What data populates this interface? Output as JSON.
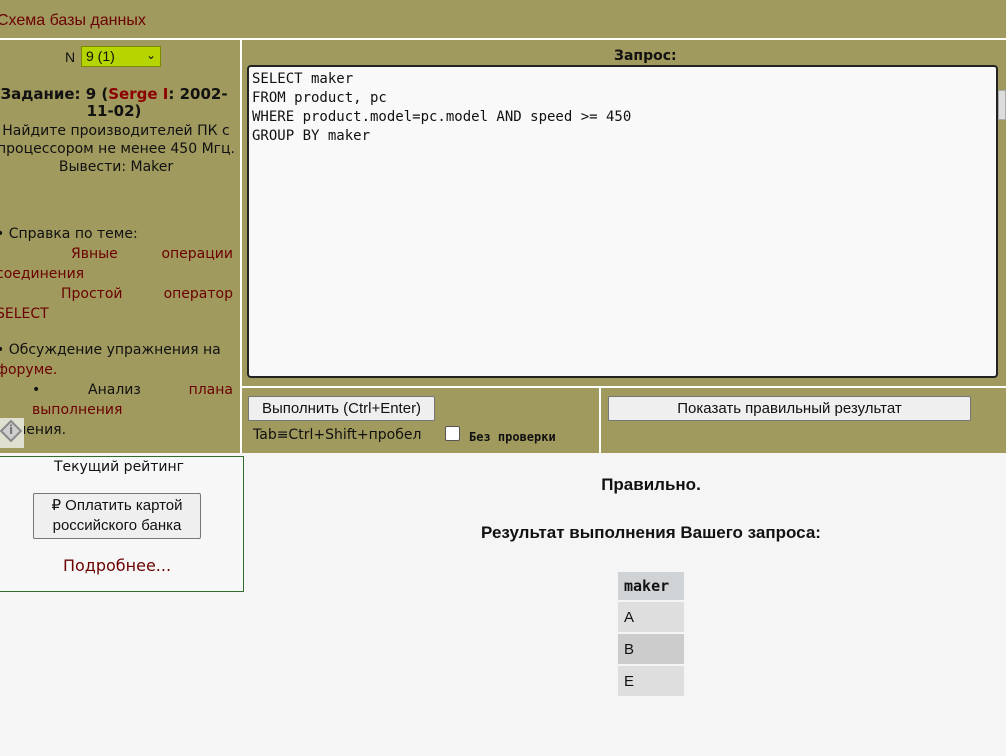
{
  "topbar": {
    "schema_link": "Схема базы данных"
  },
  "left": {
    "n_label": "N",
    "n_select_value": "9 (1)",
    "task_prefix": "Задание: 9 (",
    "task_author": "Serge I",
    "task_suffix": ": 2002-11-02)",
    "task_text": "Найдите производителей ПК с процессором не менее 450 Мгц. Вывести: Maker",
    "help_label": "• Справка по теме:",
    "help_link1": "Явные операции соединения",
    "help_link2": "Простой оператор SELECT",
    "forum_prefix": "• Обсуждение упражнения на ",
    "forum_link": "форуме.",
    "plan_prefix": "• Анализ ",
    "plan_link": "плана выполнения",
    "plan_suffix": " решения."
  },
  "query": {
    "label": "Запрос:",
    "text": "SELECT maker\nFROM product, pc\nWHERE product.model=pc.model AND speed >= 450\nGROUP BY maker"
  },
  "controls": {
    "execute_label": "Выполнить (Ctrl+Enter)",
    "tab_hint": "Tab≡Ctrl+Shift+пробел",
    "no_check_label": "Без проверки",
    "show_correct_label": "Показать правильный результат"
  },
  "rating": {
    "title": "Текущий рейтинг",
    "pay_button": "₽ Оплатить картой российского банка",
    "more_link": "Подробнее..."
  },
  "result": {
    "status": "Правильно.",
    "title": "Результат выполнения Вашего запроса:",
    "column": "maker",
    "rows": [
      "A",
      "B",
      "E"
    ]
  }
}
